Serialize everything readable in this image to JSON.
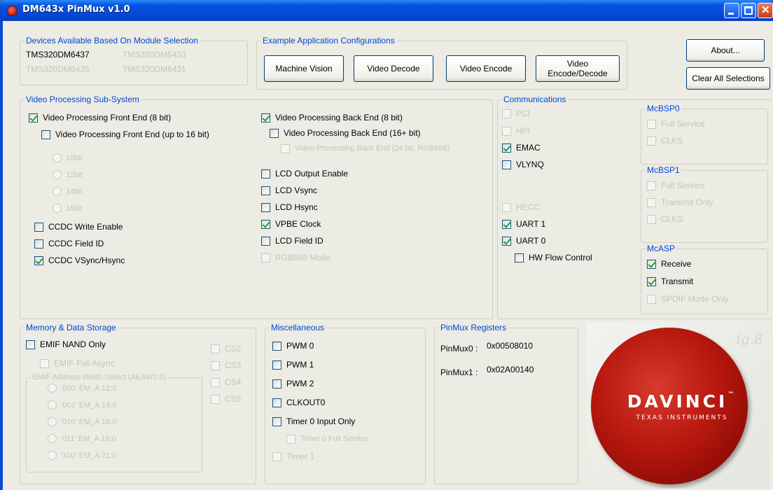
{
  "window": {
    "title": "DM643x PinMux v1.0"
  },
  "devices": {
    "title": "Devices Available Based On Module Selection",
    "items": [
      {
        "label": "TMS320DM6437",
        "enabled": true
      },
      {
        "label": "TMS320DM6433",
        "enabled": false
      },
      {
        "label": "TMS320DM6435",
        "enabled": false
      },
      {
        "label": "TMS320DM6431",
        "enabled": false
      }
    ]
  },
  "examples": {
    "title": "Example Application Configurations",
    "machine_vision": "Machine Vision",
    "video_decode": "Video Decode",
    "video_encode": "Video Encode",
    "video_encode_decode_line1": "Video",
    "video_encode_decode_line2": "Encode/Decode"
  },
  "buttons": {
    "about": "About...",
    "clear_all": "Clear All Selections"
  },
  "vpss": {
    "title": "Video Processing Sub-System",
    "front_end_8": "Video Processing Front End (8 bit)",
    "front_end_16": "Video Processing Front End (up to 16 bit)",
    "radios": [
      "10bit",
      "12bit",
      "14bit",
      "16bit"
    ],
    "ccdc_write_enable": "CCDC Write Enable",
    "ccdc_field_id": "CCDC Field ID",
    "ccdc_vsync_hsync": "CCDC VSync/Hsync",
    "back_end_8": "Video Processing Back End (8 bit)",
    "back_end_16": "Video Processing Back End (16+ bit)",
    "back_end_24": "Video Processing Back End (24 bit, RGB888)",
    "lcd_output_enable": "LCD Output Enable",
    "lcd_vsync": "LCD Vsync",
    "lcd_hsync": "LCD Hsync",
    "vpbe_clock": "VPBE Clock",
    "lcd_field_id": "LCD Field ID",
    "rgb666_mode": "RGB666 Mode"
  },
  "comms": {
    "title": "Communications",
    "pci": "PCI",
    "hpi": "HPI",
    "emac": "EMAC",
    "vlynq": "VLYNQ",
    "hecc": "HECC",
    "uart1": "UART 1",
    "uart0": "UART 0",
    "hw_flow": "HW Flow Control"
  },
  "mcbsp0": {
    "title": "McBSP0",
    "full_service": "Full Service",
    "clks": "CLKS"
  },
  "mcbsp1": {
    "title": "McBSP1",
    "full_service": "Full Service",
    "transmit_only": "Transmit Only",
    "clks": "CLKS"
  },
  "mcasp": {
    "title": "McASP",
    "receive": "Receive",
    "transmit": "Transmit",
    "spdif": "SPDIF Mode Only"
  },
  "memory": {
    "title": "Memory & Data Storage",
    "emif_nand_only": "EMIF NAND Only",
    "emif_full_async": "EMIF Full Async",
    "cs": [
      "CS2",
      "CS3",
      "CS4",
      "CS5"
    ],
    "aeaw_title": "EMIF Address Width Select (AEAW2:0)",
    "aeaw_options": [
      "'000' EM_A 12:0",
      "'001' EM_A 14:0",
      "'010' EM_A 16:0",
      "'011' EM_A 18:0",
      "'100' EM_A 21:0"
    ]
  },
  "misc": {
    "title": "Miscellaneous",
    "pwm0": "PWM 0",
    "pwm1": "PWM 1",
    "pwm2": "PWM 2",
    "clkout0": "CLKOUT0",
    "timer0_input_only": "Timer 0 Input Only",
    "timer0_full_service": "Timer 0 Full Service",
    "timer1": "Timer 1"
  },
  "pinmux": {
    "title": "PinMux Registers",
    "pm0_label": "PinMux0 :",
    "pm0_value": "0x00508010",
    "pm1_label": "PinMux1 :",
    "pm1_value": "0x02A00140"
  },
  "logo": {
    "word": "DAVINCI",
    "tm": "™",
    "sub": "TEXAS INSTRUMENTS"
  },
  "colors": {
    "group_title": "#0046d5",
    "titlebar": "#0554e3",
    "logo_red": "#b8180e"
  }
}
